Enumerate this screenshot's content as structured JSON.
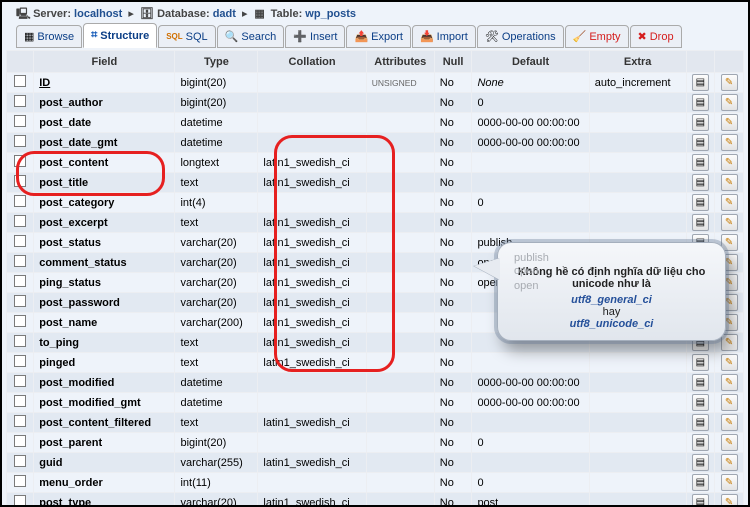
{
  "breadcrumb": {
    "server_label": "Server:",
    "server": "localhost",
    "db_label": "Database:",
    "db": "dadt",
    "tbl_label": "Table:",
    "tbl": "wp_posts"
  },
  "tabs": {
    "browse": "Browse",
    "structure": "Structure",
    "sql": "SQL",
    "search": "Search",
    "insert": "Insert",
    "export": "Export",
    "import": "Import",
    "operations": "Operations",
    "empty": "Empty",
    "drop": "Drop"
  },
  "headers": {
    "field": "Field",
    "type": "Type",
    "collation": "Collation",
    "attributes": "Attributes",
    "null": "Null",
    "default": "Default",
    "extra": "Extra"
  },
  "rows": [
    {
      "field": "ID",
      "type": "bigint(20)",
      "collation": "",
      "attr": "UNSIGNED",
      "null": "No",
      "default": "None",
      "extra": "auto_increment",
      "u": true
    },
    {
      "field": "post_author",
      "type": "bigint(20)",
      "collation": "",
      "attr": "",
      "null": "No",
      "default": "0",
      "extra": ""
    },
    {
      "field": "post_date",
      "type": "datetime",
      "collation": "",
      "attr": "",
      "null": "No",
      "default": "0000-00-00 00:00:00",
      "extra": ""
    },
    {
      "field": "post_date_gmt",
      "type": "datetime",
      "collation": "",
      "attr": "",
      "null": "No",
      "default": "0000-00-00 00:00:00",
      "extra": ""
    },
    {
      "field": "post_content",
      "type": "longtext",
      "collation": "latin1_swedish_ci",
      "attr": "",
      "null": "No",
      "default": "",
      "extra": ""
    },
    {
      "field": "post_title",
      "type": "text",
      "collation": "latin1_swedish_ci",
      "attr": "",
      "null": "No",
      "default": "",
      "extra": ""
    },
    {
      "field": "post_category",
      "type": "int(4)",
      "collation": "",
      "attr": "",
      "null": "No",
      "default": "0",
      "extra": ""
    },
    {
      "field": "post_excerpt",
      "type": "text",
      "collation": "latin1_swedish_ci",
      "attr": "",
      "null": "No",
      "default": "",
      "extra": ""
    },
    {
      "field": "post_status",
      "type": "varchar(20)",
      "collation": "latin1_swedish_ci",
      "attr": "",
      "null": "No",
      "default": "publish",
      "extra": ""
    },
    {
      "field": "comment_status",
      "type": "varchar(20)",
      "collation": "latin1_swedish_ci",
      "attr": "",
      "null": "No",
      "default": "open",
      "extra": ""
    },
    {
      "field": "ping_status",
      "type": "varchar(20)",
      "collation": "latin1_swedish_ci",
      "attr": "",
      "null": "No",
      "default": "open",
      "extra": ""
    },
    {
      "field": "post_password",
      "type": "varchar(20)",
      "collation": "latin1_swedish_ci",
      "attr": "",
      "null": "No",
      "default": "",
      "extra": ""
    },
    {
      "field": "post_name",
      "type": "varchar(200)",
      "collation": "latin1_swedish_ci",
      "attr": "",
      "null": "No",
      "default": "",
      "extra": ""
    },
    {
      "field": "to_ping",
      "type": "text",
      "collation": "latin1_swedish_ci",
      "attr": "",
      "null": "No",
      "default": "",
      "extra": ""
    },
    {
      "field": "pinged",
      "type": "text",
      "collation": "latin1_swedish_ci",
      "attr": "",
      "null": "No",
      "default": "",
      "extra": ""
    },
    {
      "field": "post_modified",
      "type": "datetime",
      "collation": "",
      "attr": "",
      "null": "No",
      "default": "0000-00-00 00:00:00",
      "extra": ""
    },
    {
      "field": "post_modified_gmt",
      "type": "datetime",
      "collation": "",
      "attr": "",
      "null": "No",
      "default": "0000-00-00 00:00:00",
      "extra": ""
    },
    {
      "field": "post_content_filtered",
      "type": "text",
      "collation": "latin1_swedish_ci",
      "attr": "",
      "null": "No",
      "default": "",
      "extra": ""
    },
    {
      "field": "post_parent",
      "type": "bigint(20)",
      "collation": "",
      "attr": "",
      "null": "No",
      "default": "0",
      "extra": ""
    },
    {
      "field": "guid",
      "type": "varchar(255)",
      "collation": "latin1_swedish_ci",
      "attr": "",
      "null": "No",
      "default": "",
      "extra": ""
    },
    {
      "field": "menu_order",
      "type": "int(11)",
      "collation": "",
      "attr": "",
      "null": "No",
      "default": "0",
      "extra": ""
    },
    {
      "field": "post_type",
      "type": "varchar(20)",
      "collation": "latin1_swedish_ci",
      "attr": "",
      "null": "No",
      "default": "post",
      "extra": ""
    }
  ],
  "bubble": {
    "title": "Không hề có định nghĩa dữ liệu cho unicode như là",
    "l1": "utf8_general_ci",
    "mid": "hay",
    "l2": "utf8_unicode_ci",
    "ghost1": "publish",
    "ghost2": "open",
    "ghost3": "open"
  }
}
